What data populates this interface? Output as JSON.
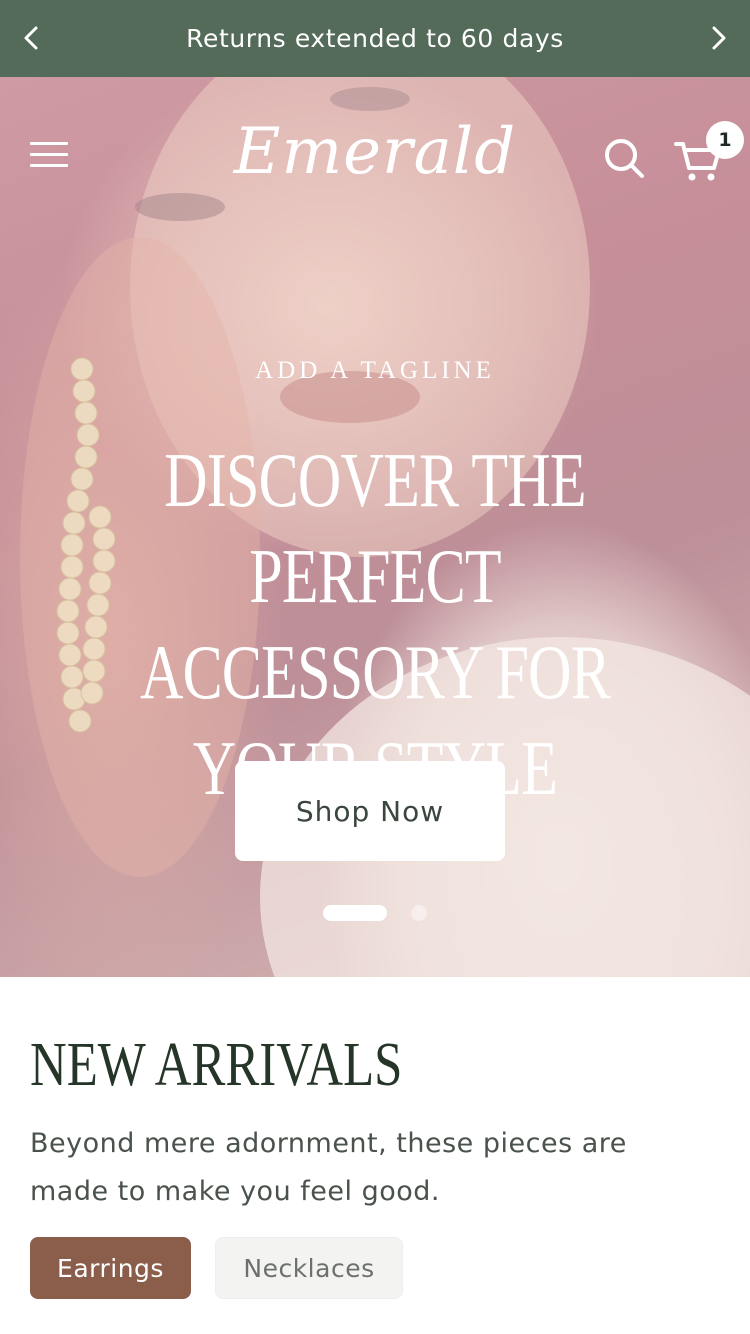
{
  "announcement": {
    "text": "Returns extended to 60 days",
    "prev_icon": "chevron-left-icon",
    "next_icon": "chevron-right-icon",
    "background": "#536b58"
  },
  "header": {
    "menu_icon": "hamburger-menu-icon",
    "logo_text": "Emerald",
    "search_icon": "search-icon",
    "cart_icon": "cart-icon",
    "cart_count": "1"
  },
  "hero": {
    "tagline": "ADD A TAGLINE",
    "headline": "DISCOVER THE PERFECT ACCESSORY FOR YOUR STYLE",
    "cta_label": "Shop Now",
    "slides_total": 2,
    "active_slide": 1
  },
  "new_arrivals": {
    "title": "NEW ARRIVALS",
    "description": "Beyond mere adornment, these pieces are made to make you feel good.",
    "tabs": [
      {
        "label": "Earrings",
        "active": true
      },
      {
        "label": "Necklaces",
        "active": false
      }
    ],
    "accent_color": "#8a5e4b"
  }
}
